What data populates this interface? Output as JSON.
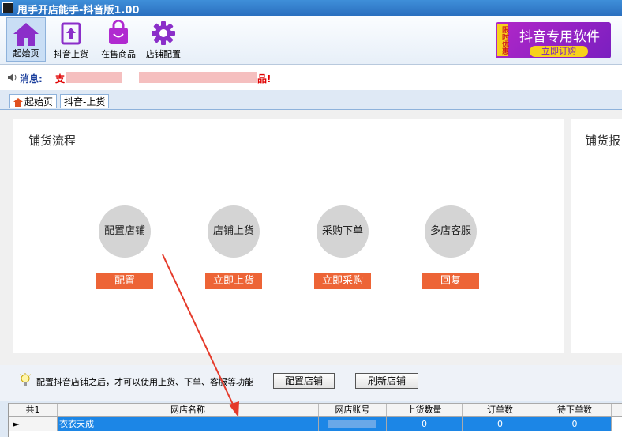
{
  "window": {
    "title": "甩手开店能手-抖音版1.00"
  },
  "toolbar": {
    "items": [
      {
        "label": "起始页",
        "icon": "home-icon"
      },
      {
        "label": "抖音上货",
        "icon": "upload-box-icon"
      },
      {
        "label": "在售商品",
        "icon": "shopping-bag-icon"
      },
      {
        "label": "店铺配置",
        "icon": "gear-icon"
      }
    ]
  },
  "promo": {
    "tag": "限时优惠",
    "title": "抖音专用软件",
    "button": "立即订购"
  },
  "message": {
    "label": "消息:",
    "text": "支",
    "end": "品!"
  },
  "tabs": [
    {
      "label": "起始页"
    },
    {
      "label": "抖音-上货"
    }
  ],
  "flow": {
    "title": "铺货流程",
    "steps": [
      {
        "label": "配置店铺",
        "button": "配置"
      },
      {
        "label": "店铺上货",
        "button": "立即上货"
      },
      {
        "label": "采购下单",
        "button": "立即采购"
      },
      {
        "label": "多店客服",
        "button": "回复"
      }
    ]
  },
  "report": {
    "title": "铺货报"
  },
  "hint": {
    "text": "配置抖音店铺之后，才可以使用上货、下单、客服等功能",
    "config_button": "配置店铺",
    "refresh_button": "刷新店铺"
  },
  "grid": {
    "count": "共1",
    "columns": [
      "网店名称",
      "网店账号",
      "上货数量",
      "订单数",
      "待下单数"
    ],
    "rows": [
      {
        "name": "衣衣天成",
        "account": "",
        "uploads": "0",
        "orders": "0",
        "pending": "0"
      }
    ]
  },
  "colors": {
    "accent": "#ed6436",
    "selection": "#1c86e6",
    "promo": "#8a22c4"
  }
}
